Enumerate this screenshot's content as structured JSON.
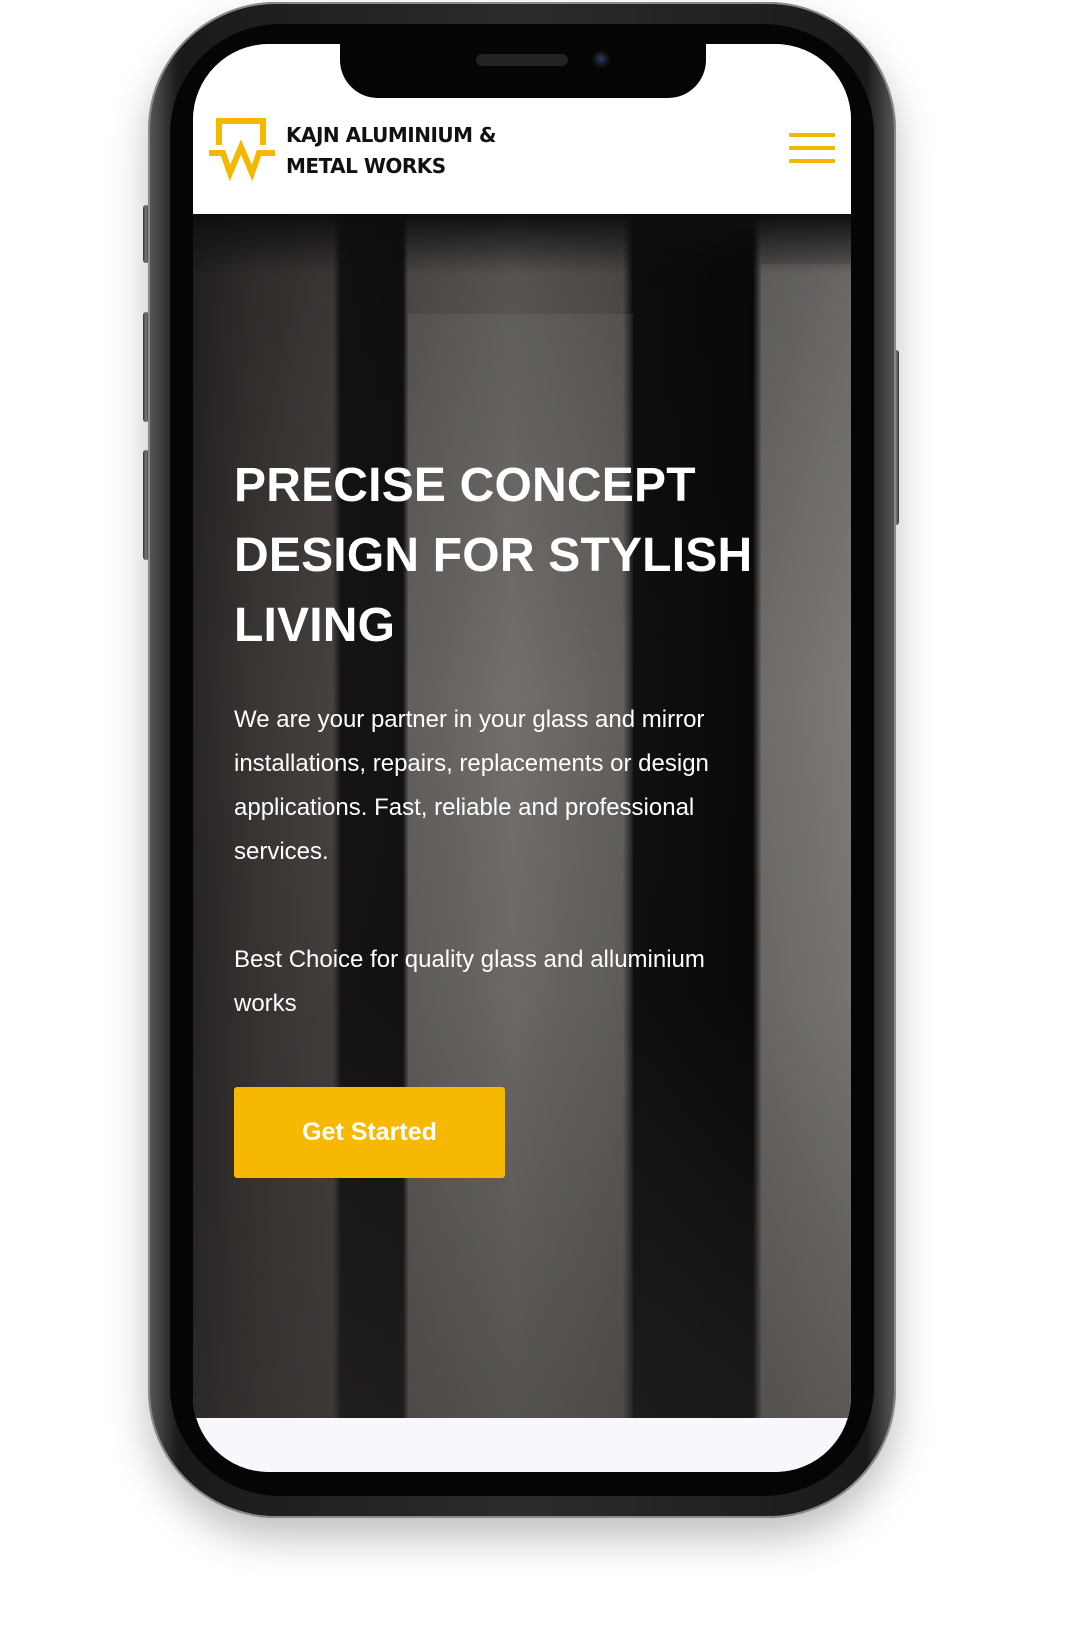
{
  "brand": {
    "name_line1": "KAJN ALUMINIUM &",
    "name_line2": "METAL WORKS",
    "accent_color": "#f5b800",
    "logo_icon": "kajn-w-logo-icon"
  },
  "header": {
    "menu_icon": "hamburger-menu-icon"
  },
  "hero": {
    "title_line1": "PRECISE CONCEPT",
    "title_line2": "DESIGN FOR STYLISH",
    "title_line3": "LIVING",
    "description_line1": "We are your partner in your glass and mirror",
    "description_line2": "installations, repairs, replacements or design",
    "description_line3": "applications. Fast, reliable and professional",
    "description_line4": "services.",
    "tagline_line1": "Best Choice for quality glass and alluminium",
    "tagline_line2": "works",
    "cta_label": "Get Started",
    "cta_color": "#f6b800"
  }
}
